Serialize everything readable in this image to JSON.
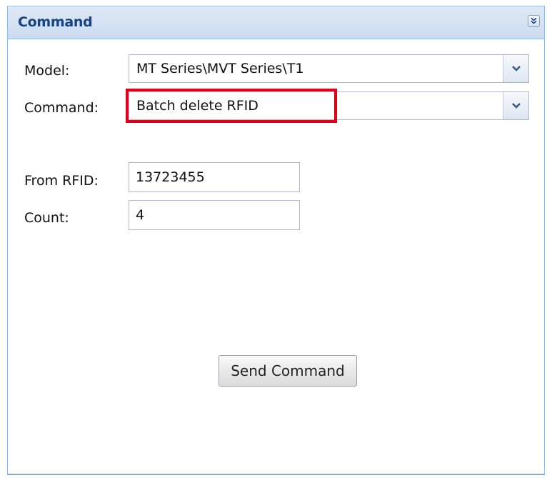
{
  "panel": {
    "title": "Command",
    "collapse_icon": "double-chevron-down-icon"
  },
  "form": {
    "model_label": "Model:",
    "model_value": "MT Series\\MVT Series\\T1",
    "command_label": "Command:",
    "command_value": "Batch delete RFID",
    "from_rfid_label": "From RFID:",
    "from_rfid_value": "13723455",
    "count_label": "Count:",
    "count_value": "4",
    "dropdown_icon": "chevron-down-icon"
  },
  "actions": {
    "send_label": "Send Command"
  },
  "colors": {
    "title": "#15428b",
    "highlight": "#e0001a",
    "border": "#99bbe8"
  }
}
